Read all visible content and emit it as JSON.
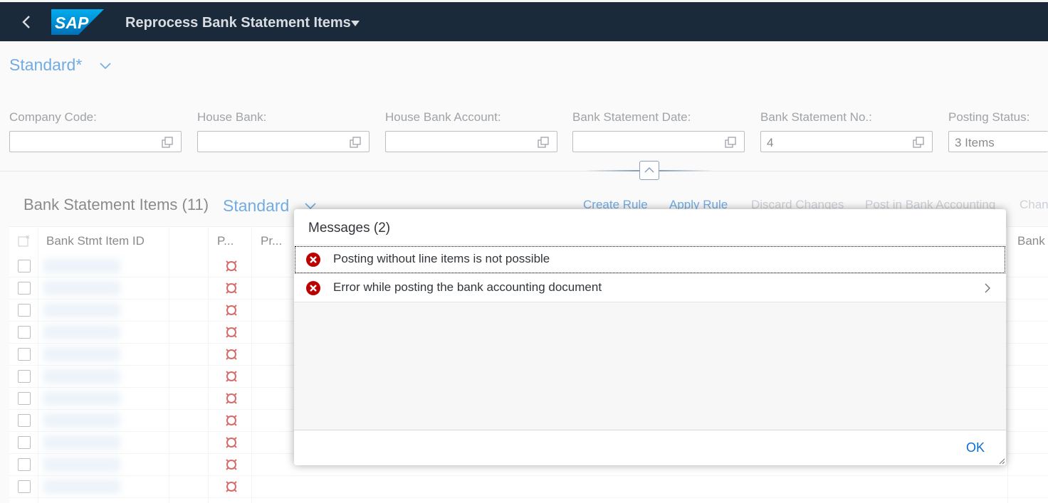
{
  "shell": {
    "logo_text": "SAP",
    "app_title": "Reprocess Bank Statement Items"
  },
  "filterbar": {
    "variant": "Standard*",
    "fields": [
      {
        "label": "Company Code:",
        "value": ""
      },
      {
        "label": "House Bank:",
        "value": ""
      },
      {
        "label": "House Bank Account:",
        "value": ""
      },
      {
        "label": "Bank Statement Date:",
        "value": ""
      },
      {
        "label": "Bank Statement No.:",
        "value": "4"
      },
      {
        "label": "Posting Status:",
        "value": "3 Items"
      }
    ]
  },
  "table": {
    "title": "Bank Statement Items (11)",
    "variant": "Standard",
    "actions": [
      {
        "label": "Create Rule",
        "state": "active"
      },
      {
        "label": "Apply Rule",
        "state": "active"
      },
      {
        "label": "Discard Changes",
        "state": "disabled"
      },
      {
        "label": "Post in Bank Accounting",
        "state": "disabled"
      },
      {
        "label": "Chan",
        "state": "disabled"
      }
    ],
    "columns": [
      "Bank Stmt Item ID",
      "P...",
      "Pr...",
      "Bank"
    ],
    "row_count": 11
  },
  "dialog": {
    "title": "Messages (2)",
    "messages": [
      {
        "type": "error",
        "text": "Posting without line items is not possible",
        "navigable": false
      },
      {
        "type": "error",
        "text": "Error while posting the bank accounting document",
        "navigable": true
      }
    ],
    "ok_label": "OK"
  },
  "colors": {
    "shell_bg": "#1b2a3b",
    "link_blue": "#0a6ed1",
    "error_red": "#bb0000"
  }
}
